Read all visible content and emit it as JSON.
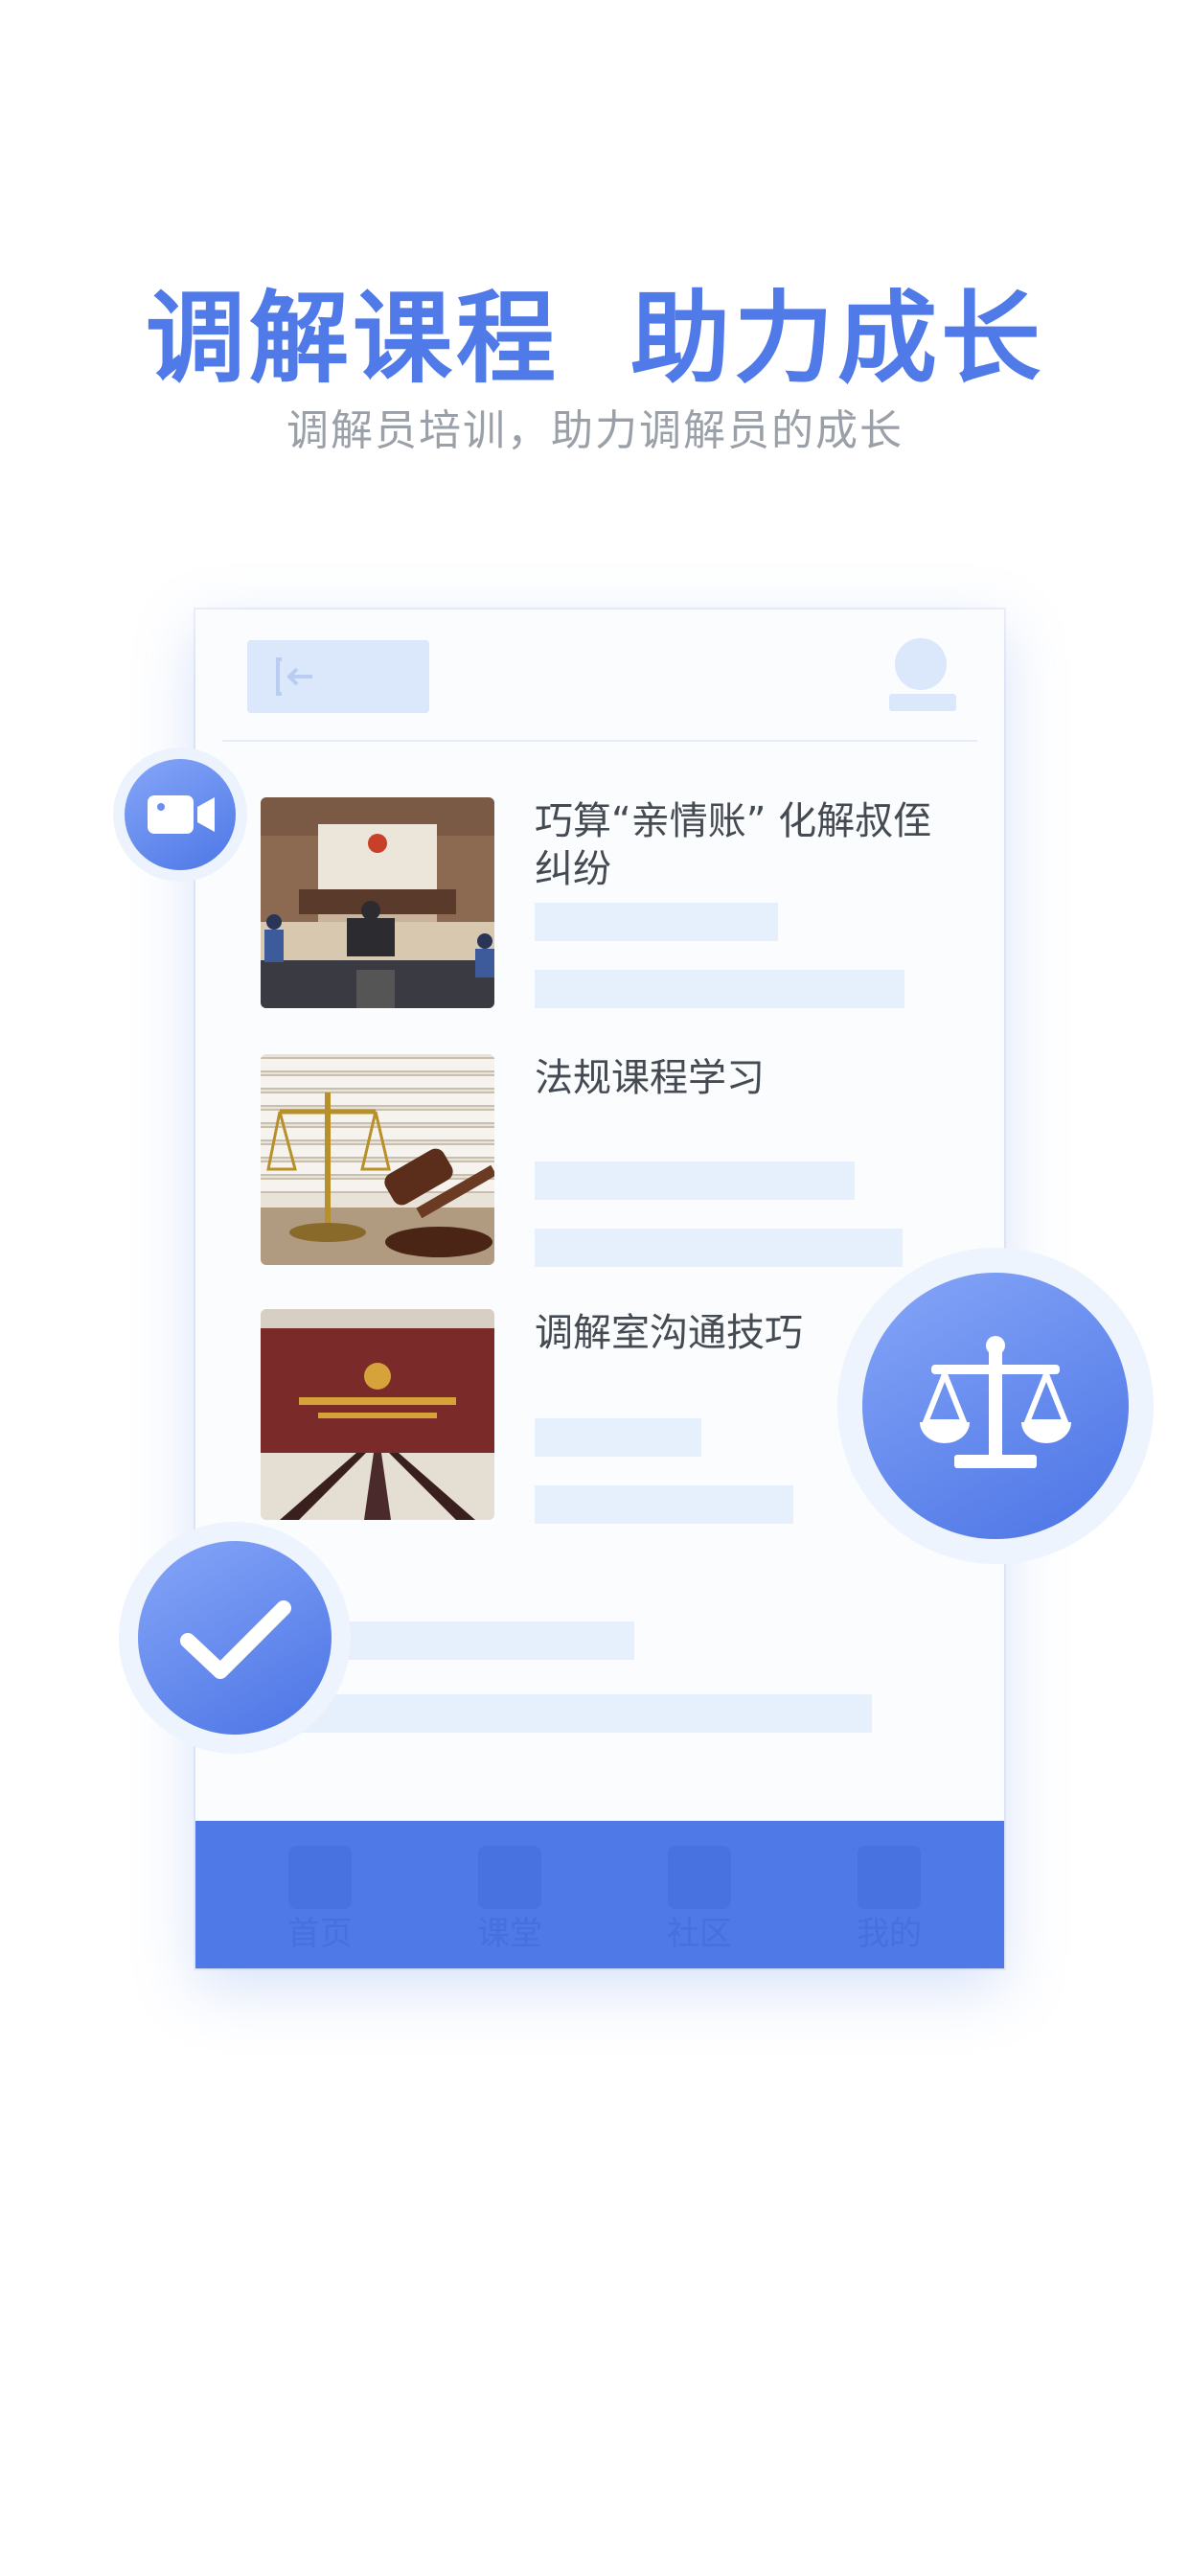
{
  "hero": {
    "title_part1": "调解课程",
    "title_part2": "助力成长",
    "subtitle": "调解员培训，助力调解员的成长"
  },
  "courses": [
    {
      "title": "巧算“亲情账” 化解叔侄纠纷",
      "image": "courtroom-photo"
    },
    {
      "title": "法规课程学习",
      "image": "gavel-scales-books-photo"
    },
    {
      "title": "调解室沟通技巧",
      "image": "mediation-room-photo"
    }
  ],
  "tabbar": {
    "items": [
      {
        "label": "首页"
      },
      {
        "label": "课堂"
      },
      {
        "label": "社区"
      },
      {
        "label": "我的"
      }
    ]
  },
  "badges": {
    "video": "video-camera-icon",
    "scale": "balance-scale-icon",
    "check": "checkmark-icon"
  },
  "colors": {
    "accent": "#4f7ae8",
    "placeholder": "#e6effc",
    "tabbar": "#4f79e6"
  }
}
